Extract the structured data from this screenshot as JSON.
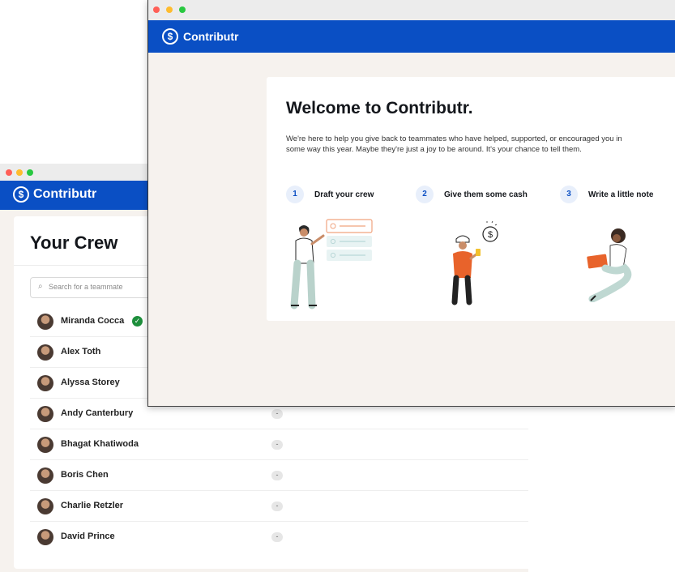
{
  "back_window": {
    "brand": "Contributr",
    "logo_symbol": "$",
    "crew": {
      "title": "Your Crew",
      "search_placeholder": "Search for a teammate",
      "members": [
        {
          "name": "Miranda Cocca",
          "verified": true
        },
        {
          "name": "Alex Toth"
        },
        {
          "name": "Alyssa Storey"
        },
        {
          "name": "Andy Canterbury",
          "amount": "-"
        },
        {
          "name": "Bhagat Khatiwoda",
          "amount": "-"
        },
        {
          "name": "Boris Chen",
          "amount": "-"
        },
        {
          "name": "Charlie Retzler",
          "amount": "-"
        },
        {
          "name": "David Prince",
          "amount": "-"
        }
      ]
    }
  },
  "front_window": {
    "brand": "Contributr",
    "logo_symbol": "$",
    "welcome": {
      "title": "Welcome to Contributr.",
      "body": "We're here to help you give back to teammates who have helped, supported, or encouraged you in some way this year. Maybe they're just a joy to be around. It's your chance to tell them.",
      "steps": [
        {
          "number": "1",
          "label": "Draft your crew"
        },
        {
          "number": "2",
          "label": "Give them some cash"
        },
        {
          "number": "3",
          "label": "Write a little note"
        }
      ]
    }
  },
  "colors": {
    "brand_blue": "#0a4fc4",
    "window_bg": "#f6f2ee",
    "verified_green": "#1e8f3c"
  },
  "icons": [
    "dollar-coin-icon",
    "search-icon",
    "check-circle-icon"
  ]
}
